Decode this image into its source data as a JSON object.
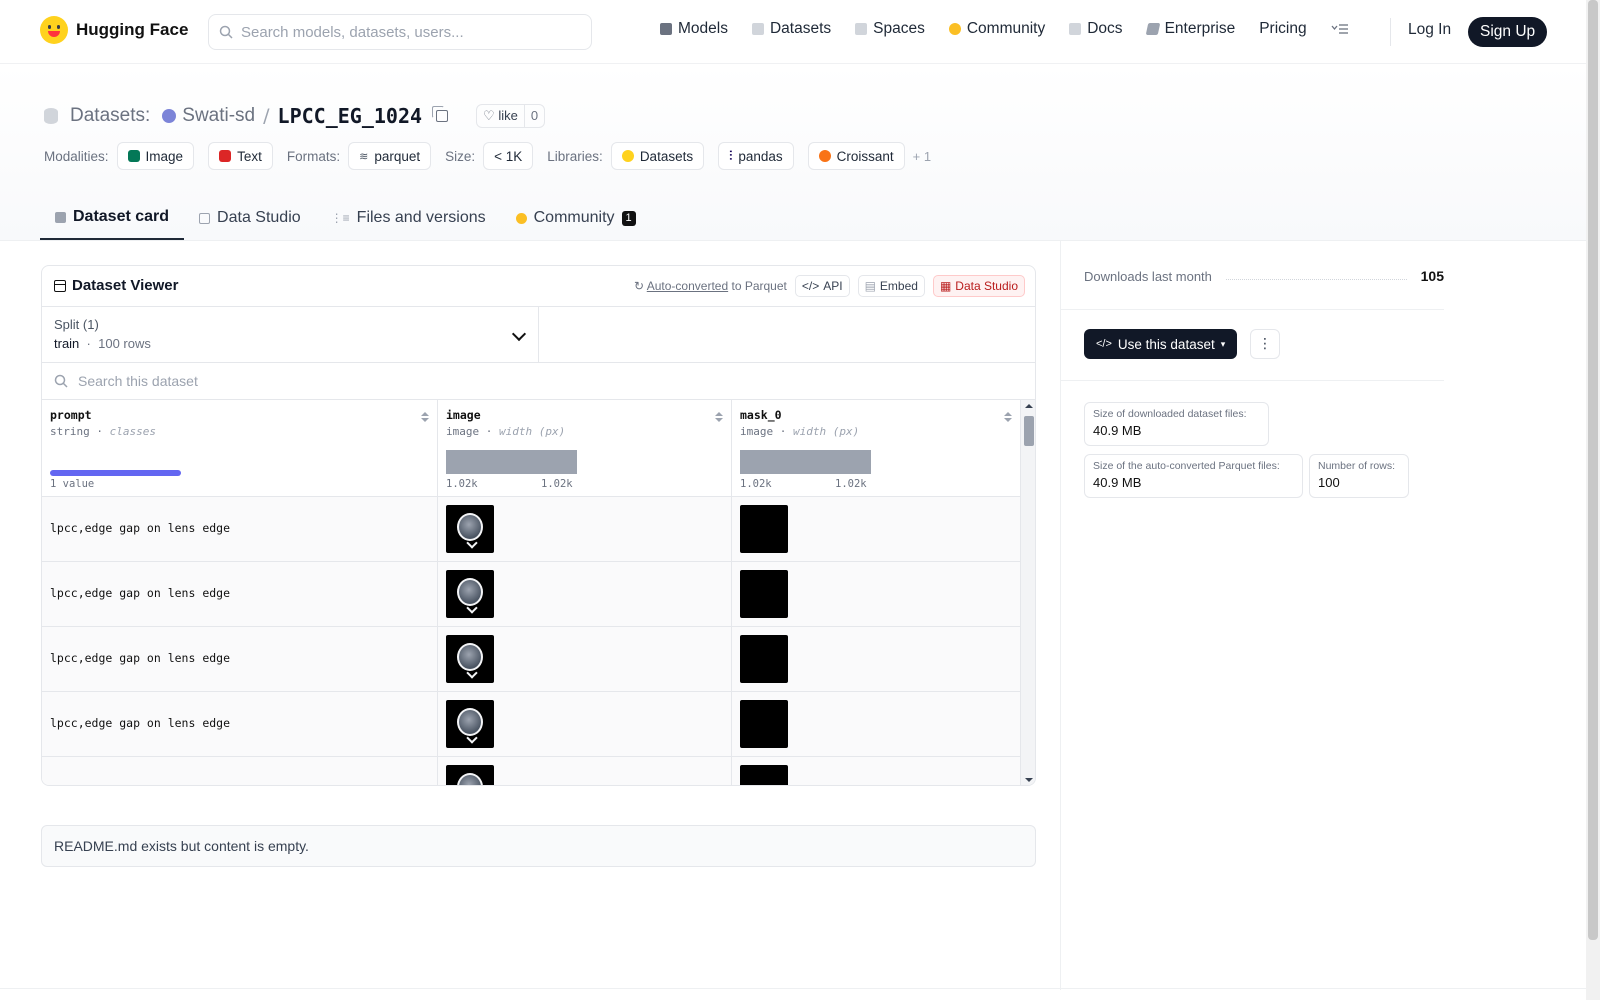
{
  "brand": {
    "name": "Hugging Face"
  },
  "search": {
    "placeholder": "Search models, datasets, users..."
  },
  "nav": [
    {
      "label": "Models",
      "icon": "models-icon",
      "color": "#6b7280"
    },
    {
      "label": "Datasets",
      "icon": "datasets-icon",
      "color": "#9ca3af"
    },
    {
      "label": "Spaces",
      "icon": "spaces-icon",
      "color": "#9ca3af"
    },
    {
      "label": "Community",
      "icon": "community-icon",
      "color": "#f59e0b"
    },
    {
      "label": "Docs",
      "icon": "docs-icon",
      "color": "#9ca3af"
    },
    {
      "label": "Enterprise",
      "icon": "enterprise-icon",
      "color": "#6b7280"
    },
    {
      "label": "Pricing",
      "icon": "",
      "color": ""
    }
  ],
  "auth": {
    "login": "Log In",
    "signup": "Sign Up"
  },
  "header": {
    "section": "Datasets:",
    "org": "Swati-sd",
    "slash": "/",
    "name": "LPCC_EG_1024",
    "like_label": "like",
    "like_count": "0"
  },
  "tags": {
    "modalities_label": "Modalities:",
    "modalities": [
      "Image",
      "Text"
    ],
    "formats_label": "Formats:",
    "format": "parquet",
    "size_label": "Size:",
    "size": "< 1K",
    "libraries_label": "Libraries:",
    "libraries": [
      "Datasets",
      "pandas",
      "Croissant"
    ],
    "more": "+ 1"
  },
  "tabs": [
    {
      "label": "Dataset card",
      "active": true
    },
    {
      "label": "Data Studio"
    },
    {
      "label": "Files and versions"
    },
    {
      "label": "Community",
      "badge": "1"
    }
  ],
  "viewer": {
    "title": "Dataset Viewer",
    "auto_converted": "Auto-converted",
    "to_parquet": "to Parquet",
    "api": "API",
    "embed": "Embed",
    "data_studio": "Data Studio",
    "split_label": "Split (1)",
    "split_value": "train",
    "split_sep": "·",
    "split_rows": "100 rows",
    "search_placeholder": "Search this dataset",
    "columns": [
      {
        "name": "prompt",
        "type": "string",
        "subtype": "classes",
        "stat": "1 value",
        "unique_fraction": 1.0
      },
      {
        "name": "image",
        "type": "image",
        "subtype": "width (px)",
        "min": "1.02k",
        "max": "1.02k"
      },
      {
        "name": "mask_0",
        "type": "image",
        "subtype": "width (px)",
        "min": "1.02k",
        "max": "1.02k"
      }
    ],
    "rows": [
      {
        "prompt": "lpcc,edge gap on lens edge"
      },
      {
        "prompt": "lpcc,edge gap on lens edge"
      },
      {
        "prompt": "lpcc,edge gap on lens edge"
      },
      {
        "prompt": "lpcc,edge gap on lens edge"
      },
      {
        "prompt": ""
      }
    ]
  },
  "readme": "README.md exists but content is empty.",
  "sidebar": {
    "downloads_label": "Downloads last month",
    "downloads": "105",
    "use_button": "Use this dataset",
    "stats": [
      {
        "label": "Size of downloaded dataset files:",
        "value": "40.9 MB"
      },
      {
        "label": "Size of the auto-converted Parquet files:",
        "value": "40.9 MB"
      },
      {
        "label": "Number of rows:",
        "value": "100"
      }
    ]
  }
}
